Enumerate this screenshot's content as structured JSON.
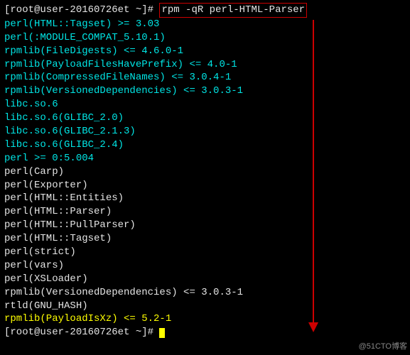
{
  "prompt1": {
    "prefix": "[root@user-20160726et ~]# ",
    "cmd": "rpm -qR perl-HTML-Parser"
  },
  "output": [
    {
      "text": "perl(HTML::Tagset) >= 3.03",
      "color": "cyan"
    },
    {
      "text": "perl(:MODULE_COMPAT_5.10.1)",
      "color": "cyan"
    },
    {
      "text": "rpmlib(FileDigests) <= 4.6.0-1",
      "color": "cyan"
    },
    {
      "text": "rpmlib(PayloadFilesHavePrefix) <= 4.0-1",
      "color": "cyan"
    },
    {
      "text": "rpmlib(CompressedFileNames) <= 3.0.4-1",
      "color": "cyan"
    },
    {
      "text": "rpmlib(VersionedDependencies) <= 3.0.3-1",
      "color": "cyan"
    },
    {
      "text": "libc.so.6",
      "color": "cyan"
    },
    {
      "text": "libc.so.6(GLIBC_2.0)",
      "color": "cyan"
    },
    {
      "text": "libc.so.6(GLIBC_2.1.3)",
      "color": "cyan"
    },
    {
      "text": "libc.so.6(GLIBC_2.4)",
      "color": "cyan"
    },
    {
      "text": "perl >= 0:5.004",
      "color": "cyan"
    },
    {
      "text": "perl(Carp)",
      "color": "white"
    },
    {
      "text": "perl(Exporter)",
      "color": "white"
    },
    {
      "text": "perl(HTML::Entities)",
      "color": "white"
    },
    {
      "text": "perl(HTML::Parser)",
      "color": "white"
    },
    {
      "text": "perl(HTML::PullParser)",
      "color": "white"
    },
    {
      "text": "perl(HTML::Tagset)",
      "color": "white"
    },
    {
      "text": "perl(strict)",
      "color": "white"
    },
    {
      "text": "perl(vars)",
      "color": "white"
    },
    {
      "text": "perl(XSLoader)",
      "color": "white"
    },
    {
      "text": "rpmlib(VersionedDependencies) <= 3.0.3-1",
      "color": "white"
    },
    {
      "text": "rtld(GNU_HASH)",
      "color": "white"
    },
    {
      "text": "rpmlib(PayloadIsXz) <= 5.2-1",
      "color": "yellow"
    }
  ],
  "prompt2": "[root@user-20160726et ~]# ",
  "watermark": "@51CTO博客"
}
